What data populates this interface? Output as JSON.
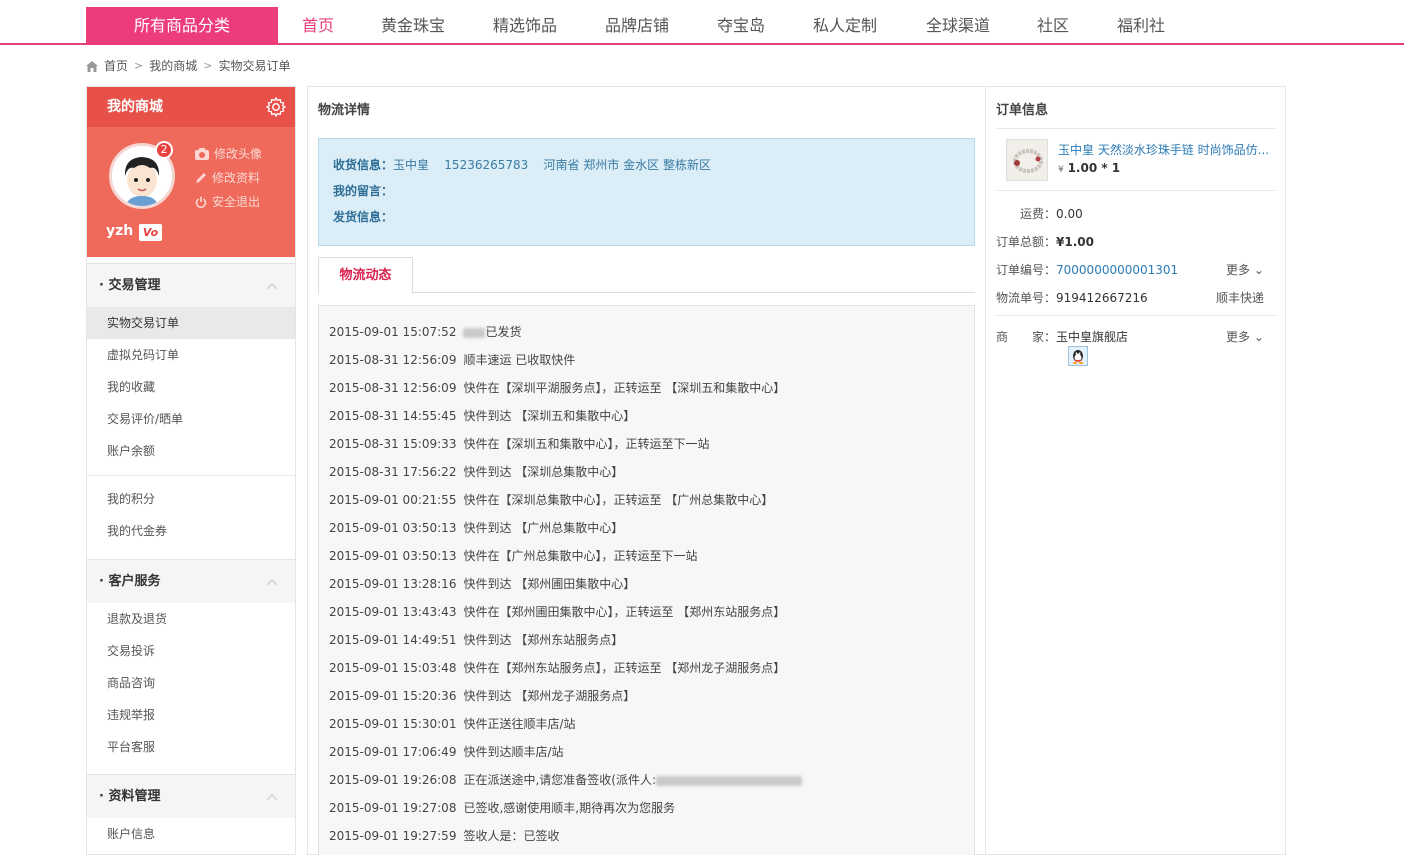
{
  "topnav": {
    "category_label": "所有商品分类",
    "items": [
      "首页",
      "黄金珠宝",
      "精选饰品",
      "品牌店铺",
      "夺宝岛",
      "私人定制",
      "全球渠道",
      "社区",
      "福利社"
    ],
    "accent": "#ec3c7c"
  },
  "breadcrumb": {
    "home": "首页",
    "mall": "我的商城",
    "current": "实物交易订单"
  },
  "profile": {
    "title": "我的商城",
    "badge": "2",
    "change_avatar": "修改头像",
    "edit_profile": "修改资料",
    "logout": "安全退出",
    "username": "yzh",
    "vip": "Vo"
  },
  "menu": {
    "trade": {
      "title": "交易管理",
      "items": [
        "实物交易订单",
        "虚拟兑码订单",
        "我的收藏",
        "交易评价/晒单",
        "账户余额"
      ],
      "extra": [
        "我的积分",
        "我的代金券"
      ]
    },
    "service": {
      "title": "客户服务",
      "items": [
        "退款及退货",
        "交易投诉",
        "商品咨询",
        "违规举报",
        "平台客服"
      ]
    },
    "data": {
      "title": "资料管理",
      "items": [
        "账户信息"
      ]
    }
  },
  "logistics": {
    "title": "物流详情",
    "receiver_label": "收货信息：",
    "receiver_name": "玉中皇",
    "receiver_phone": "15236265783",
    "receiver_addr": "河南省 郑州市 金水区 整栋新区",
    "message_label": "我的留言：",
    "ship_label": "发货信息：",
    "tab": "物流动态",
    "log": [
      {
        "time": "2015-09-01 15:07:52",
        "text": "已发货"
      },
      {
        "time": "2015-08-31 12:56:09",
        "text": "顺丰速运 已收取快件"
      },
      {
        "time": "2015-08-31 12:56:09",
        "text": "快件在【深圳平湖服务点】，正转运至 【深圳五和集散中心】"
      },
      {
        "time": "2015-08-31 14:55:45",
        "text": "快件到达 【深圳五和集散中心】"
      },
      {
        "time": "2015-08-31 15:09:33",
        "text": "快件在【深圳五和集散中心】，正转运至下一站"
      },
      {
        "time": "2015-08-31 17:56:22",
        "text": "快件到达 【深圳总集散中心】"
      },
      {
        "time": "2015-09-01 00:21:55",
        "text": "快件在【深圳总集散中心】，正转运至 【广州总集散中心】"
      },
      {
        "time": "2015-09-01 03:50:13",
        "text": "快件到达 【广州总集散中心】"
      },
      {
        "time": "2015-09-01 03:50:13",
        "text": "快件在【广州总集散中心】，正转运至下一站"
      },
      {
        "time": "2015-09-01 13:28:16",
        "text": "快件到达 【郑州圃田集散中心】"
      },
      {
        "time": "2015-09-01 13:43:43",
        "text": "快件在【郑州圃田集散中心】，正转运至 【郑州东站服务点】"
      },
      {
        "time": "2015-09-01 14:49:51",
        "text": "快件到达 【郑州东站服务点】"
      },
      {
        "time": "2015-09-01 15:03:48",
        "text": "快件在【郑州东站服务点】，正转运至 【郑州龙子湖服务点】"
      },
      {
        "time": "2015-09-01 15:20:36",
        "text": "快件到达 【郑州龙子湖服务点】"
      },
      {
        "time": "2015-09-01 15:30:01",
        "text": "快件正送往顺丰店/站"
      },
      {
        "time": "2015-09-01 17:06:49",
        "text": "快件到达顺丰店/站"
      },
      {
        "time": "2015-09-01 19:26:08",
        "text": "正在派送途中,请您准备签收(派件人:"
      },
      {
        "time": "2015-09-01 19:27:08",
        "text": "已签收,感谢使用顺丰,期待再次为您服务"
      },
      {
        "time": "2015-09-01 19:27:59",
        "text": "签收人是：已签收"
      }
    ]
  },
  "order": {
    "title": "订单信息",
    "product_name": "玉中皇 天然淡水珍珠手链 时尚饰品仿...",
    "price_symbol": "¥",
    "price": "1.00 * 1",
    "shipping_label": "运费：",
    "shipping": "0.00",
    "total_label": "订单总额：",
    "total": "¥1.00",
    "order_no_label": "订单编号：",
    "order_no": "7000000000001301",
    "more": "更多",
    "tracking_label": "物流单号：",
    "tracking_no": "919412667216",
    "carrier": "顺丰快递",
    "seller_label": "商　　家：",
    "seller": "玉中皇旗舰店"
  }
}
